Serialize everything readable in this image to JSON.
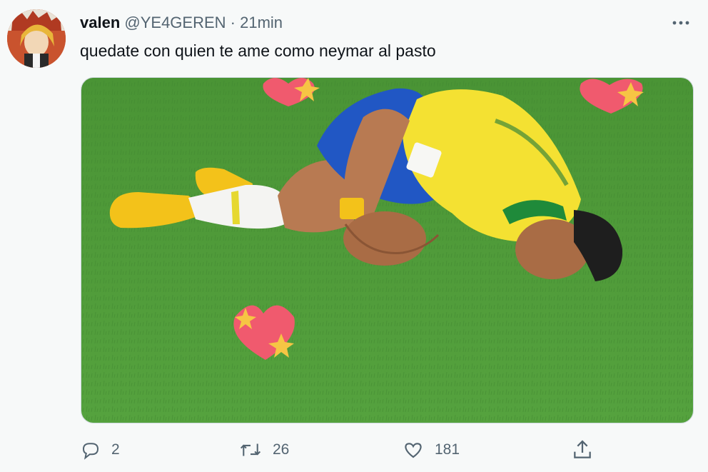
{
  "tweet": {
    "author_name": "valen",
    "author_handle": "@YE4GEREN",
    "separator": "·",
    "time": "21min",
    "text": "quedate con quien te ame como neymar al pasto",
    "avatar_icon": "user-avatar",
    "more_icon": "more-horizontal-icon",
    "media_description_icon": "tweet-photo"
  },
  "actions": {
    "reply": {
      "icon": "reply-icon",
      "count": "2"
    },
    "retweet": {
      "icon": "retweet-icon",
      "count": "26"
    },
    "like": {
      "icon": "heart-icon",
      "count": "181"
    },
    "share": {
      "icon": "share-icon"
    }
  },
  "colors": {
    "text_primary": "#0f1419",
    "text_secondary": "#536471",
    "background": "#f7f9f9",
    "grass": "#4f9a3a",
    "jersey_yellow": "#f4e132",
    "heart_pink": "#f05a6e",
    "star_gold": "#f6c544"
  }
}
